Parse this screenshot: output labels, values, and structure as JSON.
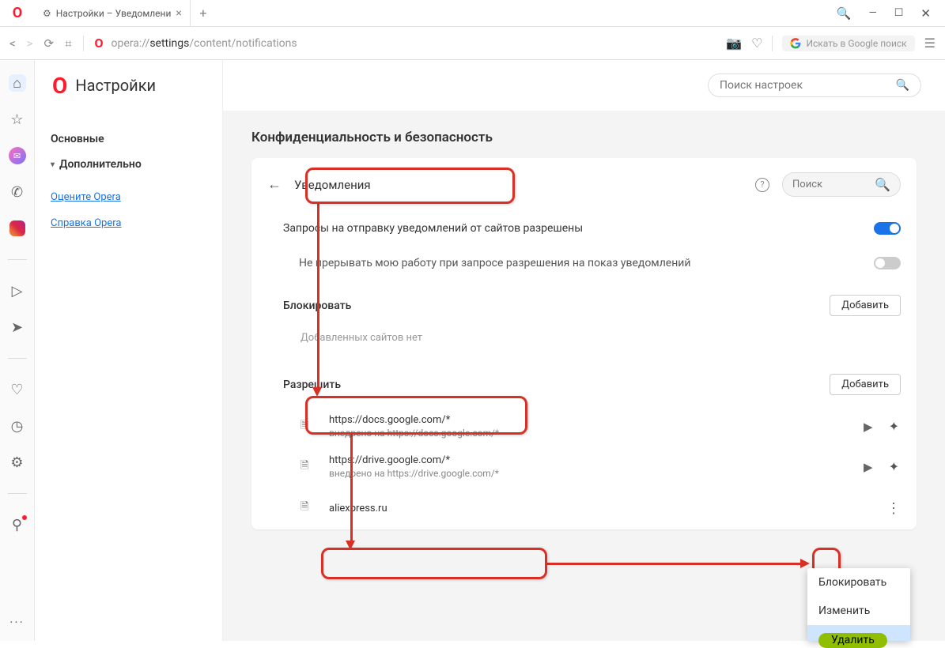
{
  "titlebar": {
    "tab_title": "Настройки – Уведомлени",
    "newtab": "+"
  },
  "addrbar": {
    "url_prefix": "opera://",
    "url_main": "settings",
    "url_suffix": "/content/notifications",
    "google_placeholder": "Искать в Google поиск"
  },
  "settings": {
    "title": "Настройки",
    "search_placeholder": "Поиск настроек",
    "nav": {
      "basic": "Основные",
      "advanced": "Дополнительно",
      "rate": "Оцените Opera",
      "help": "Справка Opera"
    }
  },
  "privacy": {
    "heading": "Конфиденциальность и безопасность",
    "back_title": "Уведомления",
    "search_placeholder": "Поиск",
    "row1": "Запросы на отправку уведомлений от сайтов разрешены",
    "row2": "Не прерывать мою работу при запросе разрешения на показ уведомлений",
    "block": {
      "title": "Блокировать",
      "add": "Добавить",
      "empty": "Добавленных сайтов нет"
    },
    "allow": {
      "title": "Разрешить",
      "add": "Добавить",
      "sites": [
        {
          "url": "https://docs.google.com/*",
          "embed": "внедрено на https://docs.google.com/*"
        },
        {
          "url": "https://drive.google.com/*",
          "embed": "внедрено на https://drive.google.com/*"
        },
        {
          "url": "aliexpress.ru",
          "embed": ""
        }
      ]
    }
  },
  "ctx": {
    "block": "Блокировать",
    "edit": "Изменить",
    "delete": "Удалить"
  }
}
